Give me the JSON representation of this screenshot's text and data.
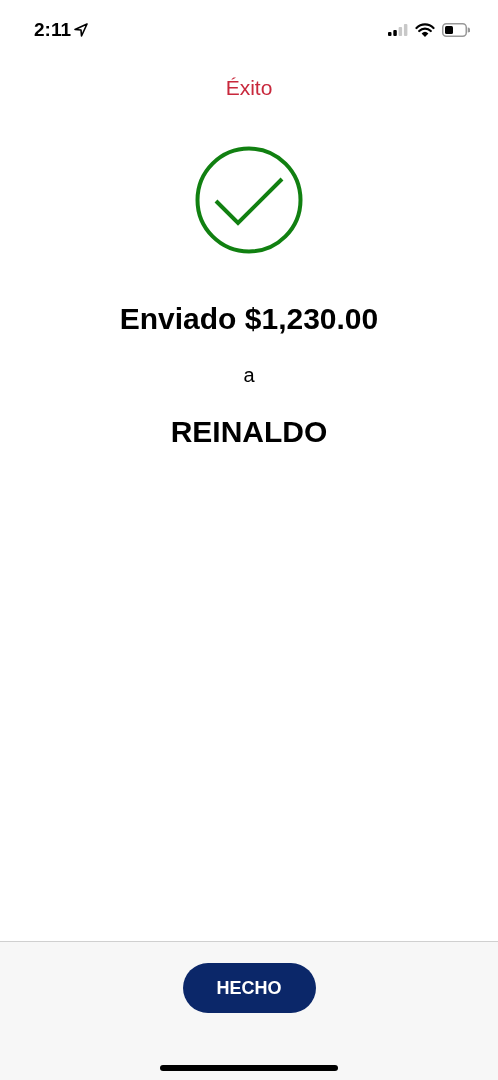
{
  "status_bar": {
    "time": "2:11"
  },
  "header": {
    "title": "Éxito"
  },
  "result": {
    "kind": "success",
    "amount_line": "Enviado $1,230.00",
    "connector": "a",
    "recipient": "REINALDO"
  },
  "footer": {
    "button": "HECHO"
  }
}
